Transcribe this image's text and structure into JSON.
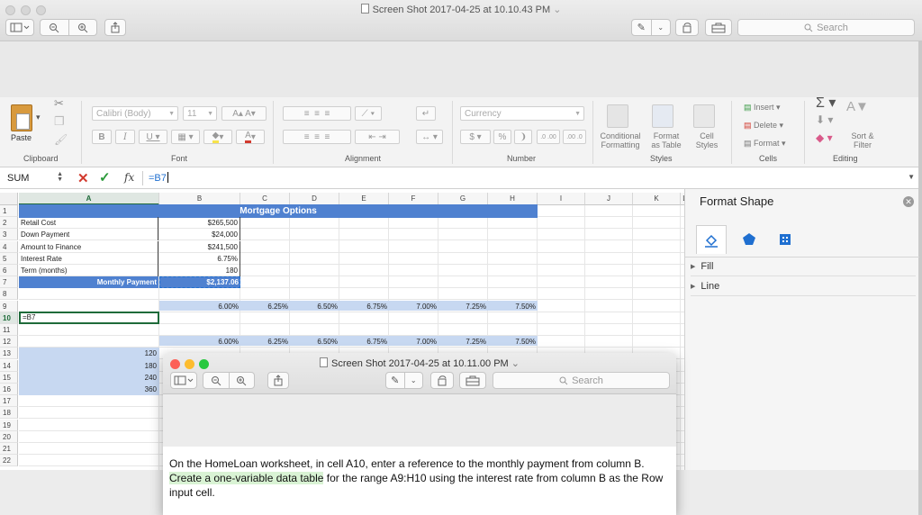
{
  "outer_window": {
    "title": "Screen Shot 2017-04-25 at 10.10.43 PM",
    "title_chevron": "⌄",
    "search_placeholder": "Search"
  },
  "ribbon": {
    "font_name": "Calibri (Body)",
    "font_size": "11",
    "number_format": "Currency",
    "paste_label": "Paste",
    "insert_label": "Insert",
    "delete_label": "Delete",
    "format_label": "Format",
    "conditional_label_1": "Conditional",
    "conditional_label_2": "Formatting",
    "format_table_1": "Format",
    "format_table_2": "as Table",
    "cell_styles_1": "Cell",
    "cell_styles_2": "Styles",
    "sort_1": "Sort &",
    "sort_2": "Filter",
    "groups": {
      "clipboard": "Clipboard",
      "font": "Font",
      "alignment": "Alignment",
      "number": "Number",
      "styles": "Styles",
      "cells": "Cells",
      "editing": "Editing"
    }
  },
  "formula_bar": {
    "name_box": "SUM",
    "fx": "fx",
    "formula": "=B7"
  },
  "sheet": {
    "columns": [
      "A",
      "B",
      "C",
      "D",
      "E",
      "F",
      "G",
      "H",
      "I",
      "J",
      "K",
      "L"
    ],
    "rows": [
      "1",
      "2",
      "3",
      "4",
      "5",
      "6",
      "7",
      "8",
      "9",
      "10",
      "11",
      "12",
      "13",
      "14",
      "15",
      "16",
      "17",
      "18",
      "19",
      "20",
      "21",
      "22"
    ],
    "title": "Mortgage Options",
    "labels": [
      "Retail Cost",
      "Down Payment",
      "Amount to Finance",
      "Interest Rate",
      "Term (months)"
    ],
    "values": [
      "$265,500",
      "$24,000",
      "$241,500",
      "6.75%",
      "180"
    ],
    "monthly_label": "Monthly Payment",
    "monthly_value": "$2,137.06",
    "rates": [
      "6.00%",
      "6.25%",
      "6.50%",
      "6.75%",
      "7.00%",
      "7.25%",
      "7.50%"
    ],
    "a10": "=B7",
    "terms": [
      "120",
      "180",
      "240",
      "360"
    ]
  },
  "pane": {
    "title": "Format Shape",
    "fill": "Fill",
    "line": "Line"
  },
  "inner_window": {
    "title": "Screen Shot 2017-04-25 at 10.11.00 PM",
    "search_placeholder": "Search",
    "instr_1": "On the HomeLoan worksheet, in cell A10, enter a reference to the monthly payment from column B. ",
    "instr_hl": "Create a one-variable data table",
    "instr_2": " for the range A9:H10 using the interest rate from column B as the Row input cell."
  }
}
